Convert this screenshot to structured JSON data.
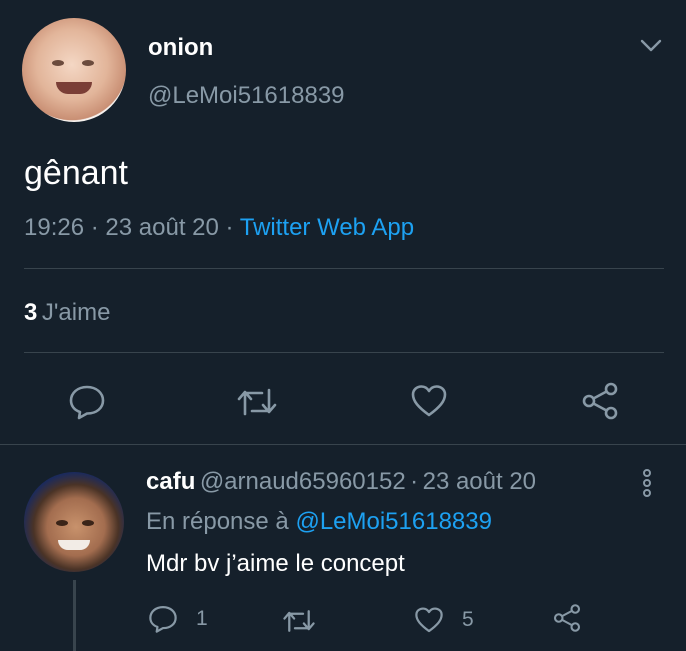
{
  "tweet": {
    "author": {
      "name": "onion",
      "handle": "@LeMoi51618839"
    },
    "text": "gênant",
    "time": "19:26",
    "date": "23 août 20",
    "source": "Twitter Web App",
    "likes_count": "3",
    "likes_label": "J'aime"
  },
  "reply": {
    "author": {
      "name": "cafu",
      "handle": "@arnaud65960152"
    },
    "date": "23 août 20",
    "in_reply_to_prefix": "En réponse à",
    "in_reply_to_mention": "@LeMoi51618839",
    "text": "Mdr bv j’aime le concept",
    "reply_count": "1",
    "like_count": "5"
  },
  "colors": {
    "background": "#15202b",
    "muted": "#8899a6",
    "accent": "#1da1f2",
    "divider": "#38444d"
  },
  "icons": {
    "more": "chevron-down-icon",
    "reply": "speech-bubble-icon",
    "retweet": "retweet-icon",
    "like": "heart-icon",
    "share": "share-icon",
    "reply_more": "vertical-dots-icon"
  },
  "separators": {
    "dot": "·"
  }
}
